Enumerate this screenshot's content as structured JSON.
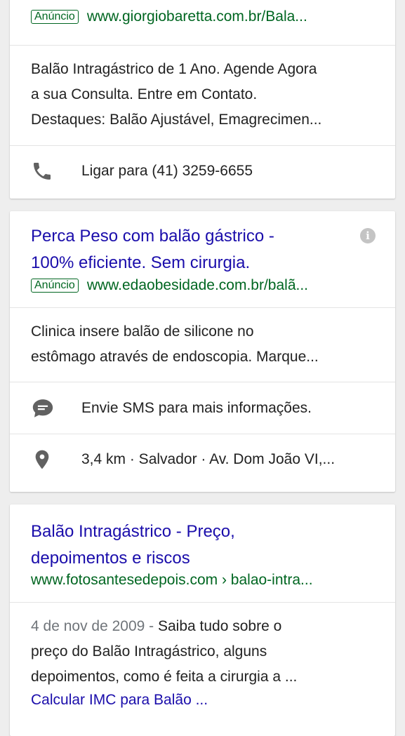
{
  "results": [
    {
      "ad_badge": "Anúncio",
      "url": "www.giorgiobaretta.com.br/Bala...",
      "description_lines": [
        "Balão Intragástrico de 1 Ano. Agende Agora",
        "a sua Consulta. Entre em Contato.",
        "Destaques: Balão Ajustável, Emagrecimen..."
      ],
      "call_text": "Ligar para (41) 3259-6655",
      "call_icon": "phone-icon"
    },
    {
      "title_lines": [
        "Perca Peso com balão gástrico -",
        "100% eficiente. Sem cirurgia."
      ],
      "ad_badge": "Anúncio",
      "url": "www.edaobesidade.com.br/balã...",
      "description_lines": [
        "Clinica insere balão de silicone no",
        "estômago através de endoscopia. Marque..."
      ],
      "sms_text": "Envie SMS para mais informações.",
      "sms_icon": "message-icon",
      "location_text": "3,4 km · Salvador · Av. Dom João VI,...",
      "location_icon": "map-pin-icon",
      "info_icon": "info-icon"
    },
    {
      "title_lines": [
        "Balão Intragástrico - Preço,",
        "depoimentos e riscos"
      ],
      "url": "www.fotosantesedepois.com › balao-intra...",
      "date": "4 de nov de 2009 - ",
      "snippet_lines": [
        "Saiba tudo sobre o",
        "preço do Balão Intragástrico, alguns",
        "depoimentos, como é feita a cirurgia a ..."
      ],
      "sitelink": "Calcular IMC para Balão ..."
    }
  ],
  "colors": {
    "title_blue": "#1a0dab",
    "url_green": "#006621",
    "text": "#222222",
    "icon_gray": "#616161",
    "background": "#eeeeee"
  }
}
